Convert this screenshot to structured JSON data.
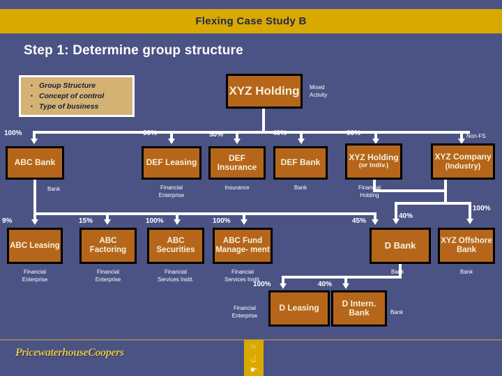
{
  "slide": {
    "title": "Flexing Case Study B",
    "step_title": "Step 1: Determine group structure",
    "background_color": "#4a5384",
    "band_color": "#d9a900",
    "node_color": "#b5661a"
  },
  "callout": {
    "bullets": [
      "Group Structure",
      "Concept of control",
      "Type of business"
    ]
  },
  "annotations": {
    "mixed_activity_l1": "Mixed",
    "mixed_activity_l2": "Activity",
    "non_fs": "Non-FS"
  },
  "nodes": {
    "xyz_holding": {
      "label": "XYZ Holding"
    },
    "abc_bank": {
      "label": "ABC Bank",
      "pct": "100%",
      "type": "Bank"
    },
    "def_leasing": {
      "label": "DEF Leasing",
      "pct": "60%",
      "type_l1": "Financial",
      "type_l2": "Enterprise"
    },
    "def_insurance": {
      "label": "DEF Insurance",
      "pct": "50%",
      "type": "Insurance"
    },
    "def_bank": {
      "label": "DEF Bank",
      "pct": "40%",
      "type": "Bank"
    },
    "xyz_holding2": {
      "label": "XYZ Holding",
      "sub": "(or Indiv.)",
      "pct": "60%",
      "type_l1": "Financial",
      "type_l2": "Holding"
    },
    "xyz_company": {
      "label": "XYZ Company",
      "sub": "(Industry)",
      "pct": "Non-FS"
    },
    "abc_leasing": {
      "label": "ABC Leasing",
      "pct": "9%",
      "type_l1": "Financial",
      "type_l2": "Enterprise"
    },
    "abc_factoring": {
      "label": "ABC Factoring",
      "pct": "15%",
      "type_l1": "Financial",
      "type_l2": "Enterprise"
    },
    "abc_securities": {
      "label": "ABC Securities",
      "pct": "100%",
      "type_l1": "Financial",
      "type_l2": "Services Instit."
    },
    "abc_fund_mgmt": {
      "label": "ABC Fund Manage- ment",
      "pct": "100%",
      "type_l1": "Financial",
      "type_l2": "Services Instit."
    },
    "d_bank": {
      "label": "D Bank",
      "pct": "45%",
      "pct2": "40%",
      "type": "Bank"
    },
    "xyz_offshore": {
      "label": "XYZ Offshore Bank",
      "pct": "100%",
      "type": "Bank"
    },
    "d_leasing": {
      "label": "D Leasing",
      "pct": "100%",
      "type_l1": "Financial",
      "type_l2": "Enterprise"
    },
    "d_intern_bank": {
      "label": "D Intern. Bank",
      "pct": "40%",
      "type": "Bank"
    }
  },
  "footer": {
    "logo_text": "PricewaterhouseCoopers",
    "nav_icons": [
      "☞",
      "☝",
      "☛"
    ]
  }
}
